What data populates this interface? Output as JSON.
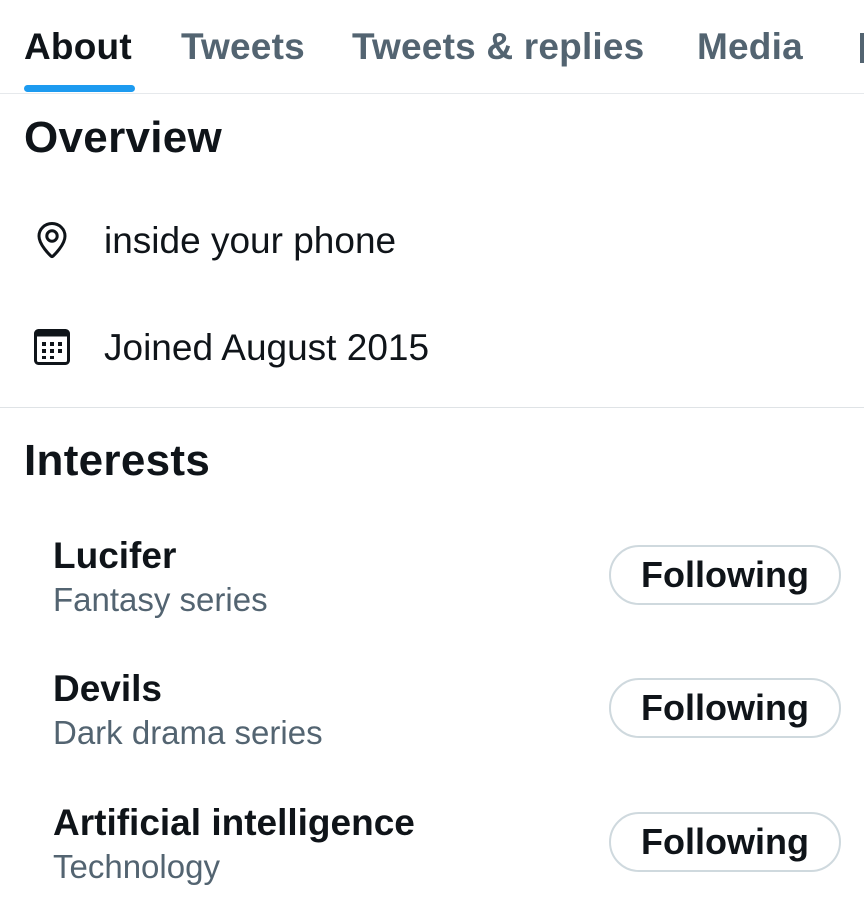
{
  "tabs": [
    {
      "label": "About",
      "active": true
    },
    {
      "label": "Tweets",
      "active": false
    },
    {
      "label": "Tweets & replies",
      "active": false
    },
    {
      "label": "Media",
      "active": false
    }
  ],
  "overview": {
    "heading": "Overview",
    "location": {
      "icon": "location-pin-icon",
      "text": "inside your phone"
    },
    "joined": {
      "icon": "calendar-icon",
      "text": "Joined August 2015"
    }
  },
  "interests": {
    "heading": "Interests",
    "items": [
      {
        "title": "Lucifer",
        "subtitle": "Fantasy series",
        "button": "Following"
      },
      {
        "title": "Devils",
        "subtitle": "Dark drama series",
        "button": "Following"
      },
      {
        "title": "Artificial intelligence",
        "subtitle": "Technology",
        "button": "Following"
      }
    ]
  },
  "colors": {
    "accent": "#1d9bf0",
    "text_primary": "#0f1419",
    "text_secondary": "#536471",
    "border": "#cfd9de"
  }
}
